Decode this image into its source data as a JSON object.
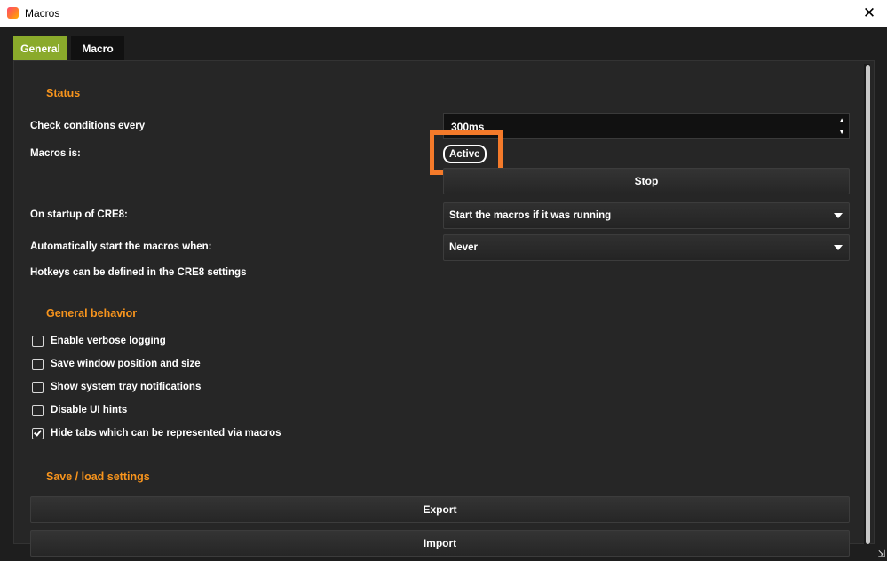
{
  "window": {
    "title": "Macros",
    "close_glyph": "✕"
  },
  "tabs": [
    {
      "label": "General",
      "active": true
    },
    {
      "label": "Macro",
      "active": false
    }
  ],
  "status": {
    "heading": "Status",
    "check_label": "Check conditions every",
    "check_value": "300ms",
    "macros_is_label": "Macros is:",
    "macros_state": "Active",
    "stop_label": "Stop",
    "startup_label": "On startup of CRE8:",
    "startup_value": "Start the macros if it was running",
    "autostart_label": "Automatically start the macros when:",
    "autostart_value": "Never",
    "hotkeys_note": "Hotkeys can be defined in the CRE8 settings"
  },
  "general": {
    "heading": "General behavior",
    "options": [
      {
        "label": "Enable verbose logging",
        "checked": false
      },
      {
        "label": "Save window position and size",
        "checked": false
      },
      {
        "label": "Show system tray notifications",
        "checked": false
      },
      {
        "label": "Disable UI hints",
        "checked": false
      },
      {
        "label": "Hide tabs which can be represented via macros",
        "checked": true
      }
    ]
  },
  "save_load": {
    "heading": "Save / load settings",
    "export_label": "Export",
    "import_label": "Import"
  },
  "colors": {
    "accent": "#f7941d",
    "tab_active": "#8aaa2b",
    "highlight": "#f47a2a"
  },
  "icons": {
    "app": "app-logo-icon",
    "close": "close-icon",
    "dropdown": "chevron-down-icon",
    "spin_up": "arrow-up-icon",
    "spin_down": "arrow-down-icon",
    "check": "checkmark-icon"
  }
}
